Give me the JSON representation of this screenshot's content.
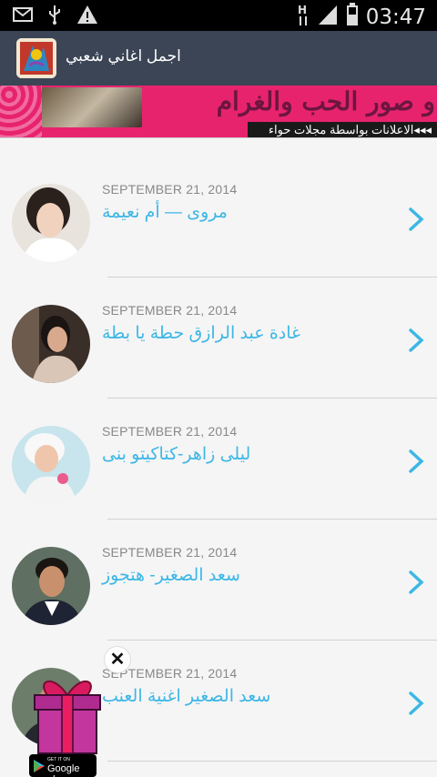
{
  "status_bar": {
    "time": "03:47",
    "icons": [
      "mail-icon",
      "usb-icon",
      "warning-icon",
      "signal-h-icon",
      "signal-bars-icon",
      "battery-icon"
    ]
  },
  "action_bar": {
    "title": "اجمل اغاني شعبي",
    "icon": "app-logo-icon"
  },
  "banner_ad": {
    "headline": "و صور الحب والغرام",
    "strip": "◂◂◂الاعلانات بواسطة مجلات حواء"
  },
  "items": [
    {
      "date": "SEPTEMBER 21, 2014",
      "title": "مروى — أم نعيمة"
    },
    {
      "date": "SEPTEMBER 21, 2014",
      "title": "غادة عبد الرازق حطة يا بطة"
    },
    {
      "date": "SEPTEMBER 21, 2014",
      "title": "ليلى زاهر-كتاكيتو بنى"
    },
    {
      "date": "SEPTEMBER 21, 2014",
      "title": "سعد الصغير- هتجوز"
    },
    {
      "date": "SEPTEMBER 21, 2014",
      "title": "سعد الصغير اغنية العنب"
    }
  ],
  "gift_ad": {
    "close": "✕",
    "badge_small": "GET IT ON",
    "badge_big": "Google play"
  },
  "colors": {
    "accent": "#3cb7e6",
    "action_bar": "#3b4556",
    "date": "#888888"
  }
}
